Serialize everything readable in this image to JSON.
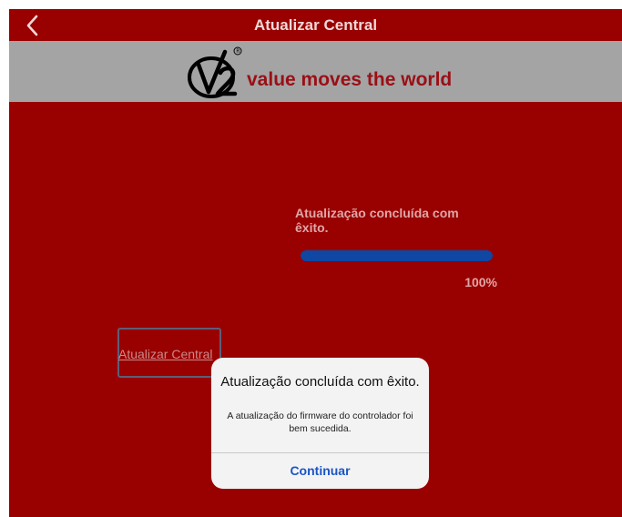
{
  "nav": {
    "title": "Atualizar Central",
    "back_icon": "chevron-left-icon"
  },
  "banner": {
    "logo": "V2-logo",
    "tagline": "value moves the world"
  },
  "progress": {
    "status": "Atualização concluída com êxito.",
    "value_percent": 100,
    "percent_label": "100%"
  },
  "update_button": {
    "label": "Atualizar Central"
  },
  "alert": {
    "title": "Atualização concluída com êxito.",
    "message": "A atualização do firmware do controlador foi bem sucedida.",
    "button": "Continuar"
  },
  "colors": {
    "background": "#990000",
    "banner": "#a4a4a4",
    "progress_fill": "#0f47a3",
    "alert_button": "#1a55c7"
  }
}
